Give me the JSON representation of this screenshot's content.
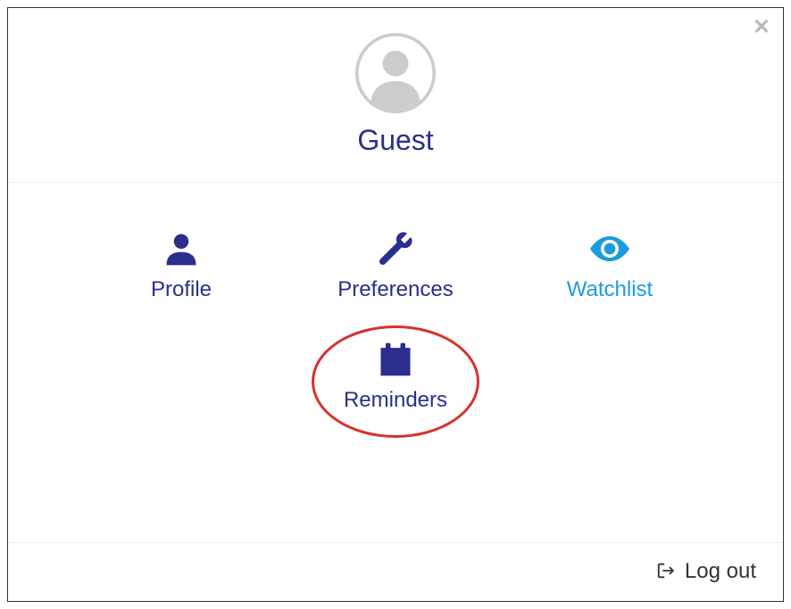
{
  "user": {
    "name": "Guest"
  },
  "menu": {
    "profile": "Profile",
    "preferences": "Preferences",
    "watchlist": "Watchlist",
    "reminders": "Reminders"
  },
  "footer": {
    "logout": "Log out"
  },
  "colors": {
    "primary": "#2b2e8c",
    "accent": "#1a9be0",
    "highlight": "#d9302c"
  }
}
